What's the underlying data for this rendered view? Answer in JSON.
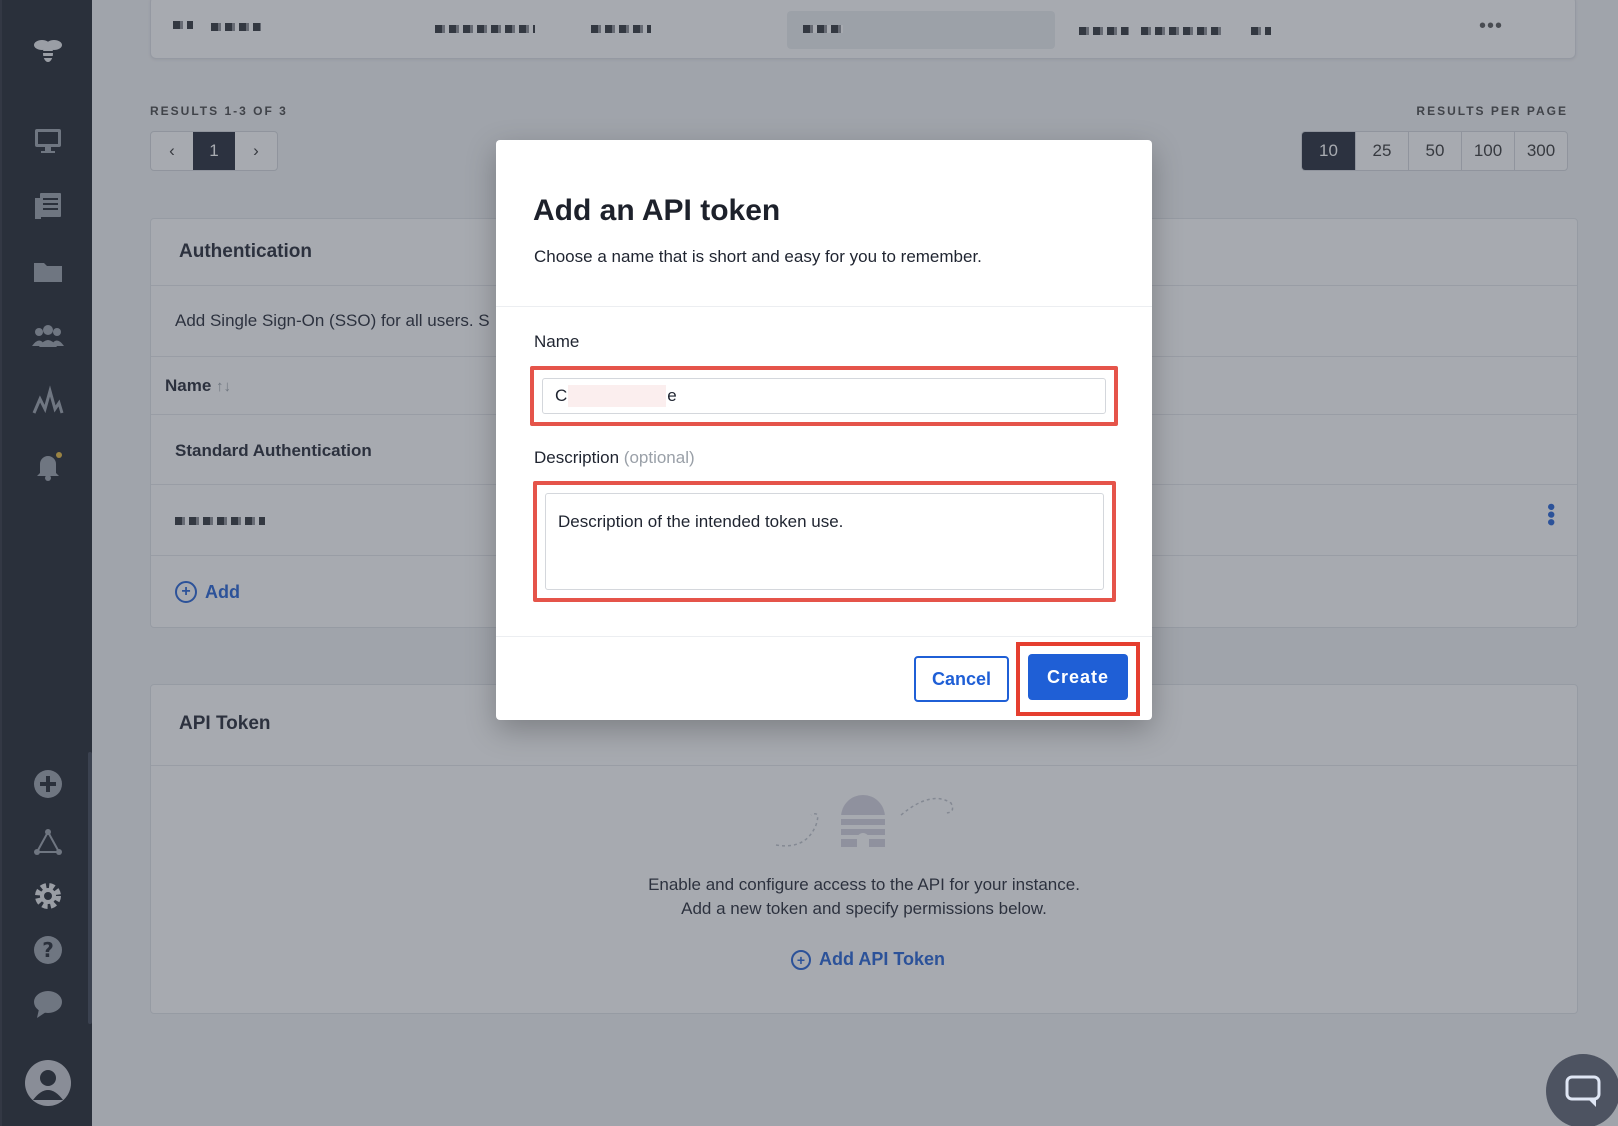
{
  "sidebar": {
    "items": [
      "bee-logo-icon",
      "monitor-icon",
      "reports-icon",
      "folder-icon",
      "users-icon",
      "activity-icon",
      "bell-icon",
      "add-circle-icon",
      "network-icon",
      "gear-icon",
      "help-icon",
      "chat-icon"
    ]
  },
  "pagination": {
    "results_label": "RESULTS 1-3 OF 3",
    "prev": "‹",
    "current_page": "1",
    "next": "›",
    "per_page_label": "RESULTS PER PAGE",
    "per_page_options": [
      "10",
      "25",
      "50",
      "100",
      "300"
    ],
    "per_page_selected": "10"
  },
  "authentication": {
    "title": "Authentication",
    "description": "Add Single Sign-On (SSO) for all users. S",
    "column_name": "Name",
    "sort_icon": "↑↓",
    "row_1": "Standard Authentication",
    "add_label": "Add"
  },
  "api_token": {
    "title": "API Token",
    "empty_line_1": "Enable and configure access to the API for your instance.",
    "empty_line_2": "Add a new token and specify permissions below.",
    "add_label": "Add API Token"
  },
  "modal": {
    "title": "Add an API token",
    "subtitle": "Choose a name that is short and easy for you to remember.",
    "name_label": "Name",
    "name_value_start": "C",
    "name_value_end": "e",
    "description_label": "Description",
    "description_optional": "(optional)",
    "description_value": "Description of the intended token use.",
    "cancel_label": "Cancel",
    "create_label": "Create"
  },
  "colors": {
    "sidebar_bg": "#1d212b",
    "primary": "#1f5fd6",
    "highlight": "#e5544a"
  }
}
